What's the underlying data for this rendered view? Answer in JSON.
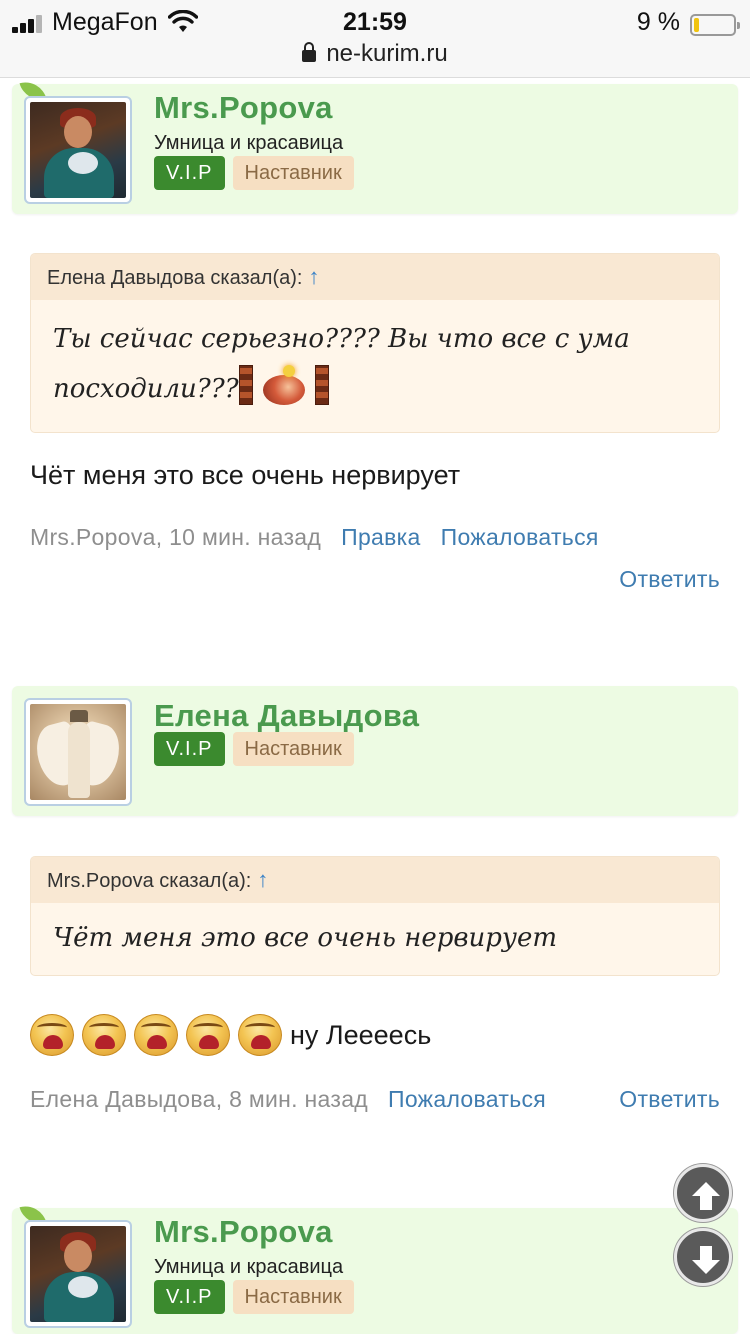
{
  "status_bar": {
    "carrier": "MegaFon",
    "time": "21:59",
    "battery": "9 %",
    "battery_level": 0.09,
    "url": "ne-kurim.ru"
  },
  "posts": [
    {
      "user": {
        "name": "Mrs.Popova",
        "status": "Умница и красавица",
        "badges": [
          "V.I.P",
          "Наставник"
        ]
      },
      "quote": {
        "author": "Елена Давыдова сказал(а):",
        "arrow": "↑",
        "text_line1": "Ты сейчас серьезно???? Вы что все с ума",
        "text_line2": "посходили???"
      },
      "text": "Чёт меня это все очень нервирует",
      "meta": {
        "author_time": "Mrs.Popova, 10 мин. назад",
        "edit": "Правка",
        "report": "Пожаловаться",
        "reply": "Ответить"
      }
    },
    {
      "user": {
        "name": "Елена Давыдова",
        "badges": [
          "V.I.P",
          "Наставник"
        ]
      },
      "quote": {
        "author": "Mrs.Popova сказал(а):",
        "arrow": "↑",
        "text": "Чёт меня это все очень нервирует"
      },
      "emoji_count": 5,
      "text": "ну Леееесь",
      "meta": {
        "author_time": "Елена Давыдова, 8 мин. назад",
        "report": "Пожаловаться",
        "reply": "Ответить"
      }
    },
    {
      "user": {
        "name": "Mrs.Popova",
        "status": "Умница и красавица",
        "badges": [
          "V.I.P",
          "Наставник"
        ]
      }
    }
  ],
  "icons": {
    "scroll_up": "arrow-up-icon",
    "scroll_down": "arrow-down-icon",
    "emoji": "crying-face-icon"
  }
}
